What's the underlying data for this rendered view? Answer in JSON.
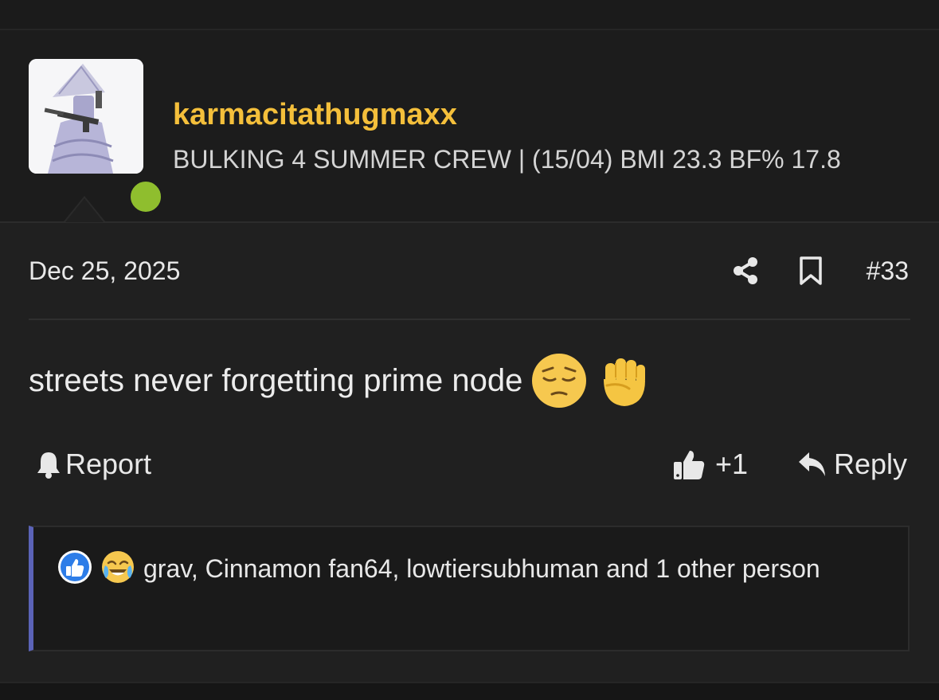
{
  "user": {
    "name": "karmacitathugmaxx",
    "title": "BULKING 4 SUMMER CREW | (15/04) BMI 23.3 BF% 17.8",
    "online_color": "#8fbe2e",
    "name_color": "#f4bf3b"
  },
  "post": {
    "date": "Dec 25, 2025",
    "number": "#33",
    "message": "streets never forgetting prime node",
    "emojis": [
      "pensive-face-emoji",
      "raised-fist-emoji"
    ]
  },
  "actions": {
    "report_label": "Report",
    "like_count": "+1",
    "reply_label": "Reply"
  },
  "reactions": {
    "icons": [
      "like-reaction-icon",
      "joy-reaction-icon"
    ],
    "summary": "grav, Cinnamon fan64, lowtiersubhuman and 1 other person",
    "accent_color": "#5b63b7"
  }
}
